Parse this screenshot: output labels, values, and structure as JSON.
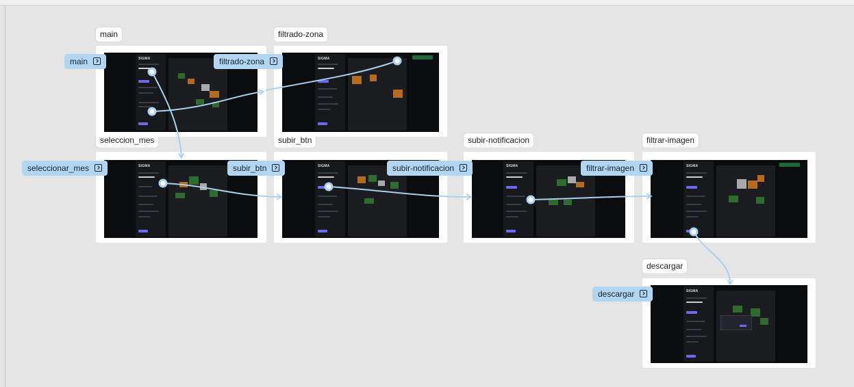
{
  "frames": {
    "main": {
      "label": "main"
    },
    "filtrado_zona": {
      "label": "filtrado-zona"
    },
    "seleccion_mes": {
      "label": "seleccion_mes"
    },
    "subir_btn": {
      "label": "subir_btn"
    },
    "subir_notificacion": {
      "label": "subir-notificacion"
    },
    "filtrar_imagen": {
      "label": "filtrar-imagen"
    },
    "descargar": {
      "label": "descargar"
    }
  },
  "flow_starts": {
    "main": "main",
    "filtrado_zona": "filtrado-zona",
    "seleccionar_mes": "seleccionar_mes",
    "subir_btn": "subir_btn",
    "subir_notificacion": "subir-notificacion",
    "filtrar_imagen": "filtrar-imagen",
    "descargar": "descargar"
  },
  "screen": {
    "app_logo": "SIGMA"
  },
  "icons": {
    "flow_start": "flow-start-icon"
  },
  "colors": {
    "canvas": "#e5e5e5",
    "connector": "#b2d6f2",
    "tag_background": "#b2d6f2",
    "app_background": "#0b0c0e",
    "accent_button": "#6b6cf2"
  }
}
